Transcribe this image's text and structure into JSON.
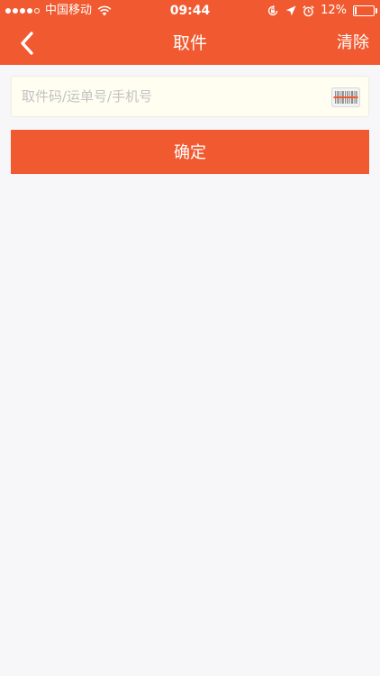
{
  "status_bar": {
    "carrier": "中国移动",
    "time": "09:44",
    "battery_percent": "12%",
    "battery_level": 0.12,
    "icons": [
      "signal-dots",
      "wifi-icon",
      "rotation-lock-icon",
      "location-arrow-icon",
      "alarm-icon",
      "battery-icon"
    ]
  },
  "nav": {
    "back_icon": "chevron-left-icon",
    "title": "取件",
    "right_action": "清除"
  },
  "search": {
    "placeholder": "取件码/运单号/手机号",
    "value": "",
    "scan_icon": "barcode-scan-icon"
  },
  "confirm_button": {
    "label": "确定"
  },
  "colors": {
    "brand": "#f15a31",
    "background": "#f7f7f9",
    "input_background": "#fffef1",
    "placeholder": "#c2c2c2"
  }
}
